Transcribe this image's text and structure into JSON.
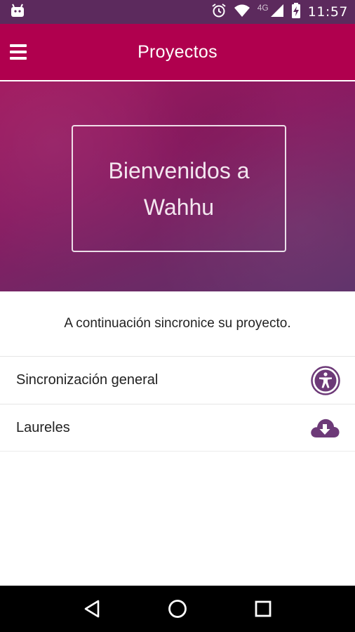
{
  "status_bar": {
    "time": "11:57",
    "network": "4G",
    "icons": [
      "android-icon",
      "alarm-icon",
      "wifi-icon",
      "signal-icon",
      "battery-charging-icon"
    ]
  },
  "app_bar": {
    "title": "Proyectos",
    "menu_icon": "hamburger-menu-icon"
  },
  "hero": {
    "welcome_line1": "Bienvenidos a",
    "welcome_line2": "Wahhu"
  },
  "main": {
    "intro_text": "A continuación sincronice su proyecto.",
    "items": [
      {
        "label": "Sincronización general",
        "icon": "accessibility-icon"
      },
      {
        "label": "Laureles",
        "icon": "cloud-download-icon"
      }
    ]
  },
  "nav_bar": {
    "icons": [
      "back-icon",
      "home-icon",
      "recents-icon"
    ]
  },
  "colors": {
    "status_bar": "#5c2a5d",
    "app_bar": "#b0004e",
    "accent_purple": "#6d3a78"
  }
}
